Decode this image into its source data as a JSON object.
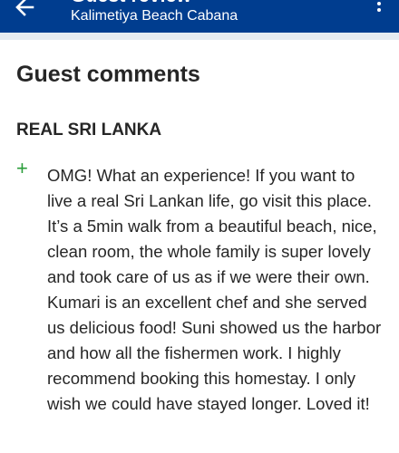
{
  "app_bar": {
    "title": "Guest review",
    "subtitle": "Kalimetiya Beach Cabana",
    "icons": {
      "back": "arrow-left-icon",
      "more": "more-vertical-icon"
    }
  },
  "section": {
    "heading": "Guest comments"
  },
  "comment": {
    "title": "REAL SRI LANKA",
    "icon": "plus-icon",
    "body": "OMG! What an experience! If you want to live a real Sri Lankan life, go visit this place. It’s a 5min walk from a beautiful beach, nice, clean room, the whole family is super lovely and took care of us as if we were their own. Kumari is an excellent chef and she served us delicious food! Suni showed us the harbor and how all the fishermen work. I highly recommend booking this homestay. I only wish we could have stayed longer. Loved it!"
  },
  "colors": {
    "app_bar": "#003d8f",
    "divider": "#e6ebf1",
    "positive": "#2a9d3a",
    "text": "#262626"
  }
}
